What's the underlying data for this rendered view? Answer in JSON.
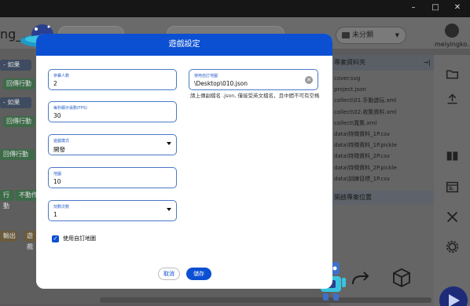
{
  "window": {
    "controls": [
      "–",
      "□",
      "✕"
    ]
  },
  "header": {
    "project_name": "ng_...",
    "folder_select": "未分類",
    "user_name": "meiyingko..."
  },
  "workspace": {
    "blocks": [
      "- 如果",
      "回傳行動",
      "- 如果",
      "回傳行動",
      "回傳行動",
      "行動",
      "不動作",
      "輸出",
      "遊戲"
    ]
  },
  "project_panel": {
    "title": "專案資料夾",
    "files": [
      "cover.svg",
      "project.json",
      "collect\\01.手動遊玩.xml",
      "collect\\02.收集資料.xml",
      "collect\\寬集.xml",
      "data\\特徵資料_1P.csv",
      "data\\特徵資料_1P.pickle",
      "data\\特徵資料_2P.csv",
      "data\\特徵資料_2P.pickle",
      "data\\訓練目標_1P.csv"
    ],
    "footer": "開啟專案位置"
  },
  "side_icons": [
    "folder-icon",
    "upload-icon",
    "book-icon",
    "window-icon",
    "tools-icon",
    "gear-icon"
  ],
  "dialog": {
    "title": "遊戲設定",
    "fields": {
      "players": {
        "label": "參賽人數",
        "value": "2"
      },
      "fps": {
        "label": "每秒顯示張數(FPS)",
        "value": "30"
      },
      "mode": {
        "label": "遊戲模式",
        "value": "開發"
      },
      "map": {
        "label": "地圖",
        "value": "10"
      },
      "frames": {
        "label": "刻數次數",
        "value": "1"
      },
      "custom_map": {
        "label": "使用自訂地圖",
        "value": "\\Desktop\\010.json"
      }
    },
    "help_text": "請上傳副檔名 .json, 僅接受英文檔名，且中間不可有空格",
    "checkbox_label": "使用自訂地圖",
    "checkbox_checked": true,
    "cancel_label": "取消",
    "save_label": "儲存"
  },
  "colors": {
    "accent": "#0b4fd3",
    "field_border": "#4a79c6",
    "run_button": "#1d2b79"
  }
}
